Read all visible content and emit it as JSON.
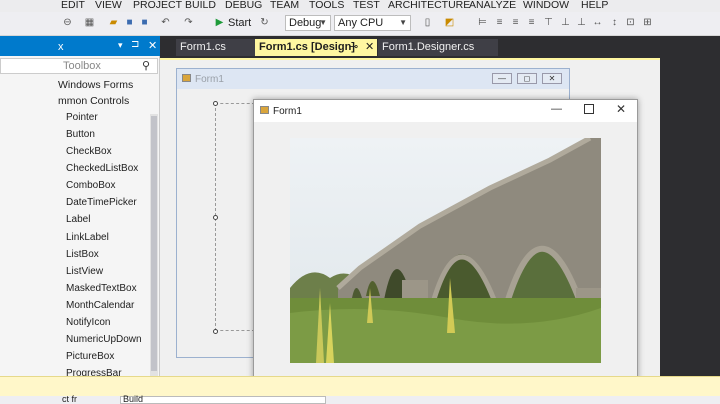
{
  "menu": [
    "EDIT",
    "VIEW",
    "PROJECT",
    "BUILD",
    "DEBUG",
    "TEAM",
    "TOOLS",
    "TEST",
    "ARCHITECTURE",
    "ANALYZE",
    "WINDOW",
    "HELP"
  ],
  "toolbar": {
    "start_label": "Start",
    "config": "Debug",
    "platform": "Any CPU"
  },
  "toolbox": {
    "title": "x",
    "search_placeholder": "Toolbox",
    "group_all": "Windows Forms",
    "group_common": "mmon Controls",
    "items": [
      "Pointer",
      "Button",
      "CheckBox",
      "CheckedListBox",
      "ComboBox",
      "DateTimePicker",
      "Label",
      "LinkLabel",
      "ListBox",
      "ListView",
      "MaskedTextBox",
      "MonthCalendar",
      "NotifyIcon",
      "NumericUpDown",
      "PictureBox",
      "ProgressBar"
    ]
  },
  "tabs": [
    {
      "label": "Form1.cs",
      "active": false
    },
    {
      "label": "Form1.cs [Design]",
      "active": true
    },
    {
      "label": "Form1.Designer.cs",
      "active": false
    }
  ],
  "designer_form": {
    "title": "Form1"
  },
  "running_form": {
    "title": "Form1",
    "picture_alt": "stone arch bridge"
  },
  "bottom": {
    "label": "ct fr",
    "value": "Build"
  },
  "colors": {
    "accent": "#007acc",
    "dark_bg": "#2d2d30",
    "active_tab": "#fff7a1",
    "output_bar": "#fff7c9"
  }
}
